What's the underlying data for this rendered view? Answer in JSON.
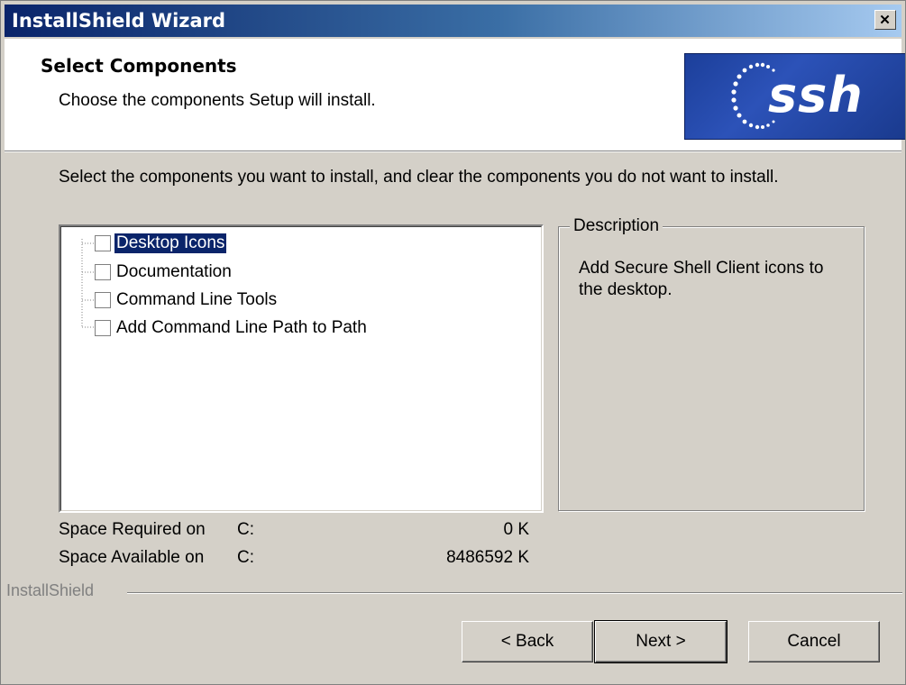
{
  "window": {
    "title": "InstallShield Wizard"
  },
  "header": {
    "title": "Select Components",
    "subtitle": "Choose the components Setup will install.",
    "logo_text": "ssh"
  },
  "instructions": "Select the components you want to install, and clear the components you do not want to install.",
  "components": [
    {
      "label": "Desktop Icons",
      "checked": false,
      "selected": true
    },
    {
      "label": "Documentation",
      "checked": false,
      "selected": false
    },
    {
      "label": "Command Line Tools",
      "checked": false,
      "selected": false
    },
    {
      "label": "Add Command Line Path to Path",
      "checked": false,
      "selected": false
    }
  ],
  "description": {
    "legend": "Description",
    "text": "Add Secure Shell Client icons to the desktop."
  },
  "space": {
    "required": {
      "label": "Space Required on",
      "drive": "C:",
      "value": "0 K"
    },
    "available": {
      "label": "Space Available on",
      "drive": "C:",
      "value": "8486592 K"
    }
  },
  "brand": "InstallShield",
  "buttons": {
    "back": "< Back",
    "next": "Next >",
    "cancel": "Cancel"
  },
  "colors": {
    "titlebar_start": "#0a246a",
    "titlebar_end": "#a6caf0",
    "selection": "#0a246a",
    "dialog_bg": "#d4d0c8"
  }
}
